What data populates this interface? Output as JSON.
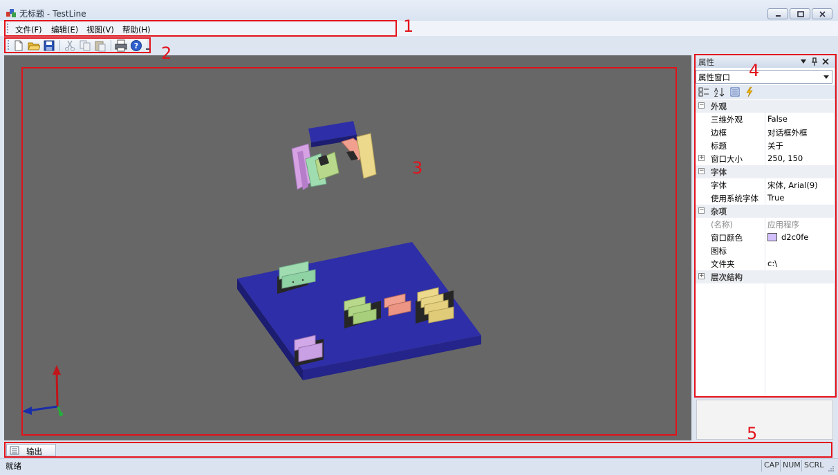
{
  "window": {
    "title": "无标题 - TestLine"
  },
  "menu": {
    "items": [
      "文件(F)",
      "编辑(E)",
      "视图(V)",
      "帮助(H)"
    ]
  },
  "toolbar": {
    "buttons": [
      "new-file-icon",
      "open-folder-icon",
      "save-icon",
      "cut-icon",
      "copy-icon",
      "paste-icon",
      "print-icon",
      "help-icon"
    ]
  },
  "properties": {
    "title": "属性",
    "object_combo": "属性窗口",
    "categories": [
      {
        "name": "外观",
        "rows": [
          {
            "name": "三维外观",
            "value": "False"
          },
          {
            "name": "边框",
            "value": "对话框外框"
          },
          {
            "name": "标题",
            "value": "关于"
          },
          {
            "name": "窗口大小",
            "value": "250, 150"
          }
        ]
      },
      {
        "name": "字体",
        "rows": [
          {
            "name": "字体",
            "value": "宋体, Arial(9)"
          },
          {
            "name": "使用系统字体",
            "value": "True"
          }
        ]
      },
      {
        "name": "杂项",
        "rows": [
          {
            "name": "(名称)",
            "value": "应用程序"
          },
          {
            "name": "窗口颜色",
            "value": "d2c0fe"
          },
          {
            "name": "图标",
            "value": ""
          },
          {
            "name": "文件夹",
            "value": "c:\\"
          }
        ]
      },
      {
        "name": "层次结构",
        "rows": []
      }
    ],
    "window_color_swatch": "#d2c0fe"
  },
  "output": {
    "tab_label": "输出"
  },
  "status": {
    "text": "就绪",
    "indicators": [
      "CAP",
      "NUM",
      "SCRL"
    ]
  },
  "annotations": [
    "1",
    "2",
    "3",
    "4",
    "5"
  ],
  "colors": {
    "annotation": "#e3121a",
    "viewport_bg": "#676767",
    "platform": "#2e2eaa"
  }
}
